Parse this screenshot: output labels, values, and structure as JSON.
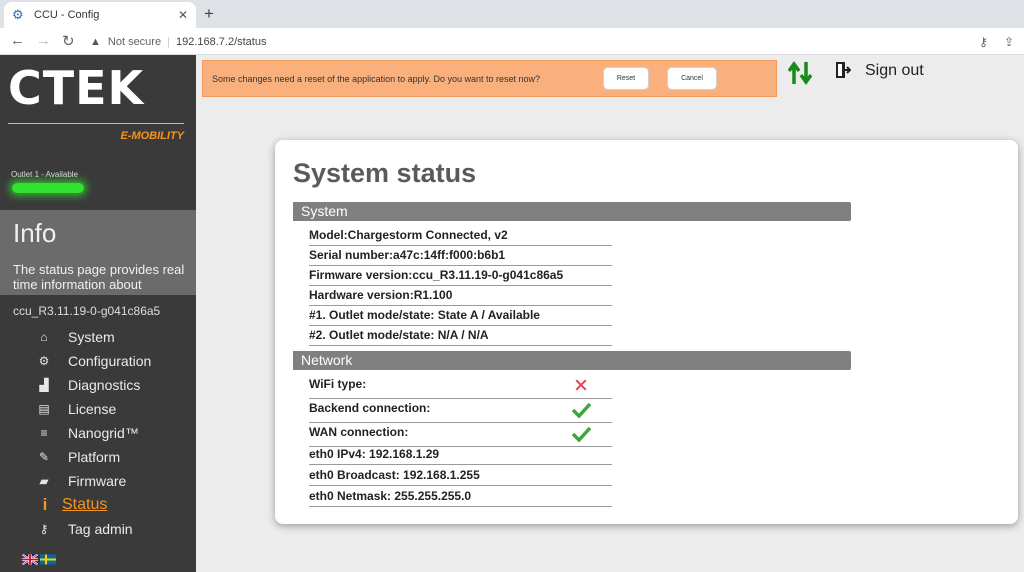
{
  "browser": {
    "tab_title": "CCU - Config",
    "security_label": "Not secure",
    "url": "192.168.7.2/status"
  },
  "sidebar": {
    "logo_text": "CTEK",
    "logo_subtext": "E-MOBILITY",
    "outlet_status": "Outlet 1 - Available",
    "outlet_bar_color": "#2ee22e",
    "info_title": "Info",
    "info_description": "The status page provides real time information about",
    "version": "ccu_R3.11.19-0-g041c86a5",
    "menu": [
      {
        "label": "System",
        "icon": "home-icon",
        "glyph": "⌂"
      },
      {
        "label": "Configuration",
        "icon": "gear-icon",
        "glyph": "⚙"
      },
      {
        "label": "Diagnostics",
        "icon": "bar-chart-icon",
        "glyph": "▟"
      },
      {
        "label": "License",
        "icon": "license-icon",
        "glyph": "▤"
      },
      {
        "label": "Nanogrid™",
        "icon": "sliders-icon",
        "glyph": "≡"
      },
      {
        "label": "Platform",
        "icon": "wrench-icon",
        "glyph": "✎"
      },
      {
        "label": "Firmware",
        "icon": "folder-icon",
        "glyph": "▰"
      },
      {
        "label": "Status",
        "icon": "info-icon",
        "glyph": "i"
      },
      {
        "label": "Tag admin",
        "icon": "key-icon",
        "glyph": "⚷"
      }
    ],
    "active_index": 7,
    "accent_color": "#f7941d"
  },
  "notice": {
    "message": "Some changes need a reset of the application to apply. Do you want to reset now?",
    "reset_label": "Reset",
    "cancel_label": "Cancel",
    "background_color": "#f9b07c"
  },
  "header": {
    "signout_label": "Sign out"
  },
  "main": {
    "title": "System status",
    "system_section": "System",
    "system_rows": [
      "Model:Chargestorm Connected, v2",
      "Serial number:a47c:14ff:f000:b6b1",
      "Firmware version:ccu_R3.11.19-0-g041c86a5",
      "Hardware version:R1.100",
      "#1. Outlet mode/state: State A / Available",
      "#2. Outlet mode/state: N/A / N/A"
    ],
    "network_section": "Network",
    "network_rows": [
      {
        "label": "WiFi type:",
        "status": "fail"
      },
      {
        "label": "Backend connection:",
        "status": "ok"
      },
      {
        "label": "WAN connection:",
        "status": "ok"
      },
      {
        "label": "eth0 IPv4: 192.168.1.29"
      },
      {
        "label": "eth0 Broadcast: 192.168.1.255"
      },
      {
        "label": "eth0 Netmask: 255.255.255.0"
      }
    ],
    "ok_color": "#3aa93a",
    "fail_color": "#e0474c"
  }
}
